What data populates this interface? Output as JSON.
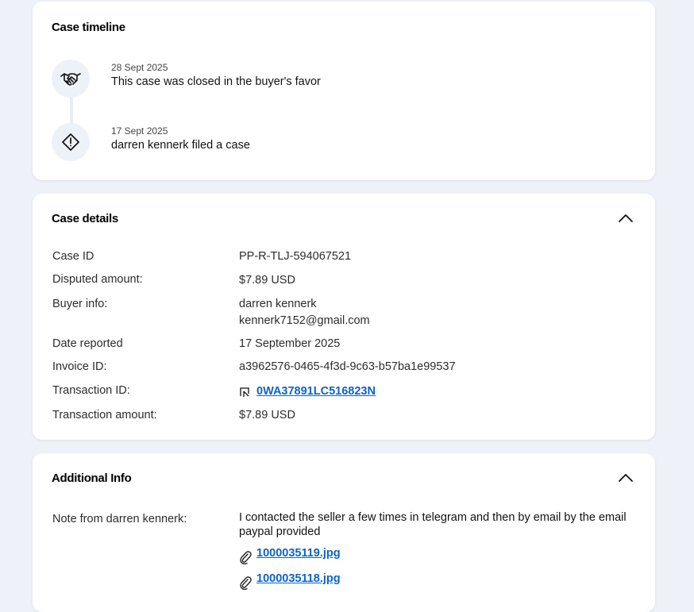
{
  "timeline": {
    "title": "Case timeline",
    "events": [
      {
        "date": "28 Sept 2025",
        "text": "This case was closed in the buyer's favor",
        "icon": "handshake-icon"
      },
      {
        "date": "17 Sept 2025",
        "text": "darren kennerk filed a case",
        "icon": "warning-diamond-icon"
      }
    ]
  },
  "details": {
    "title": "Case details",
    "rows": {
      "case_id": {
        "label": "Case ID",
        "value": "PP-R-TLJ-594067521"
      },
      "disputed_amount": {
        "label": "Disputed amount:",
        "value": "$7.89 USD"
      },
      "buyer_info": {
        "label": "Buyer info:",
        "name": "darren kennerk",
        "email": "kennerk7152@gmail.com"
      },
      "date_reported": {
        "label": "Date reported",
        "value": "17 September 2025"
      },
      "invoice_id": {
        "label": "Invoice ID:",
        "value": "a3962576-0465-4f3d-9c63-b57ba1e99537"
      },
      "transaction_id": {
        "label": "Transaction ID:",
        "value": "0WA37891LC516823N"
      },
      "transaction_amount": {
        "label": "Transaction amount:",
        "value": "$7.89 USD"
      }
    }
  },
  "additional": {
    "title": "Additional Info",
    "note_label": "Note from darren kennerk:",
    "note_text": "I contacted the seller a few times in telegram and then by email by the email paypal provided",
    "attachments": [
      "1000035119.jpg",
      "1000035118.jpg"
    ]
  },
  "colors": {
    "link": "#0a64c8",
    "page_bg": "#eef1f8"
  }
}
